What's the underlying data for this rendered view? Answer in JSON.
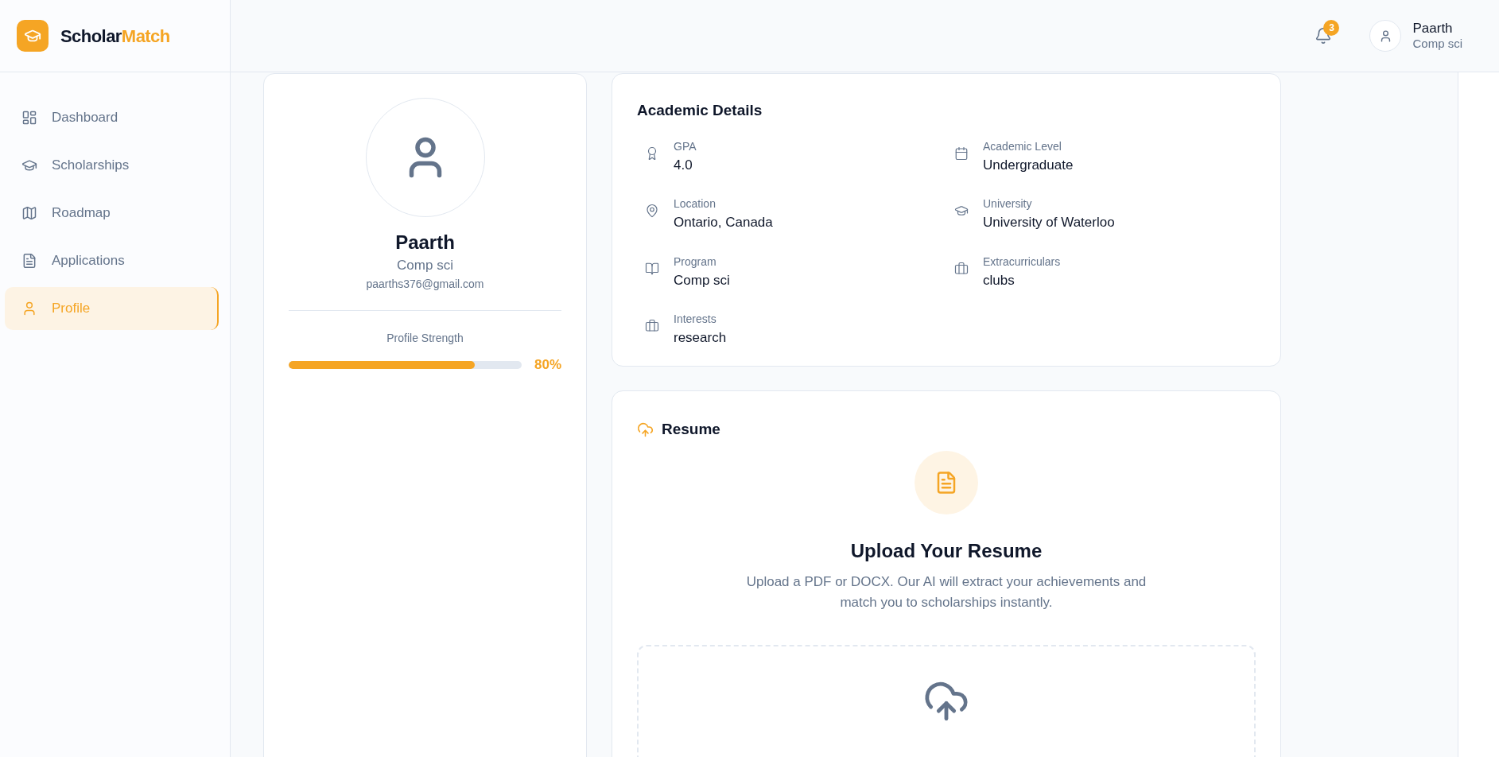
{
  "brand": {
    "name_part1": "Scholar",
    "name_part2": "Match"
  },
  "sidebar": {
    "items": [
      {
        "label": "Dashboard",
        "selected": false
      },
      {
        "label": "Scholarships",
        "selected": false
      },
      {
        "label": "Roadmap",
        "selected": false
      },
      {
        "label": "Applications",
        "selected": false
      },
      {
        "label": "Profile",
        "selected": true
      }
    ]
  },
  "header": {
    "notifications": {
      "count": "3"
    },
    "user": {
      "name": "Paarth",
      "subtitle": "Comp sci"
    }
  },
  "profile_card": {
    "name": "Paarth",
    "program": "Comp sci",
    "email": "paarths376@gmail.com",
    "strength": {
      "label": "Profile Strength",
      "level": 0.8,
      "reading": "80%"
    }
  },
  "academic_details": {
    "title": "Academic Details",
    "fields": [
      {
        "label": "GPA",
        "value": "4.0"
      },
      {
        "label": "Academic Level",
        "value": "Undergraduate"
      },
      {
        "label": "Location",
        "value": "Ontario, Canada"
      },
      {
        "label": "University",
        "value": "University of Waterloo"
      },
      {
        "label": "Program",
        "value": "Comp sci"
      },
      {
        "label": "Extracurriculars",
        "value": "clubs"
      },
      {
        "label": "Interests",
        "value": "research"
      }
    ]
  },
  "resume": {
    "title": "Resume",
    "heading": "Upload Your Resume",
    "description": "Upload a PDF or DOCX. Our AI will extract your achievements and match you to scholarships instantly."
  }
}
